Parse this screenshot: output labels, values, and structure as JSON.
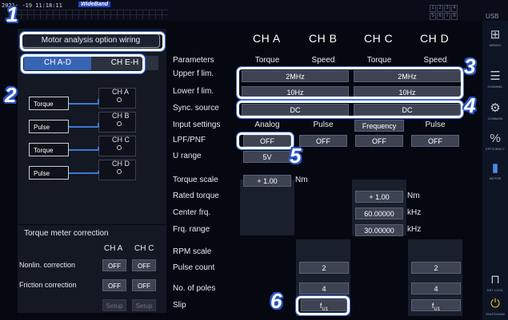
{
  "status_bar": {
    "clock": "2021-  -19 11:18:11",
    "mode": "WideBand",
    "usb": "USB",
    "channels": [
      "1",
      "2",
      "3",
      "4",
      "5",
      "6",
      "7",
      "8"
    ]
  },
  "left_panel": {
    "title": "Motor analysis option wiring",
    "tabs": [
      {
        "label": "CH A-D",
        "active": true
      },
      {
        "label": "CH E-H",
        "active": false
      }
    ],
    "wiring": [
      {
        "signal": "Torque",
        "channel": "CH A"
      },
      {
        "signal": "Pulse",
        "channel": "CH B"
      },
      {
        "signal": "Torque",
        "channel": "CH C"
      },
      {
        "signal": "Pulse",
        "channel": "CH D"
      }
    ]
  },
  "torque_meter_correction": {
    "title": "Torque meter correction",
    "columns": [
      "CH A",
      "CH C"
    ],
    "rows": [
      {
        "label": "Nonlin. correction",
        "values": [
          "OFF",
          "OFF"
        ]
      },
      {
        "label": "Friction correction",
        "values": [
          "OFF",
          "OFF"
        ]
      },
      {
        "label": "",
        "values": [
          "Setup",
          "Setup"
        ]
      }
    ]
  },
  "main": {
    "channels": [
      "CH A",
      "CH B",
      "CH C",
      "CH D"
    ],
    "row_labels": {
      "parameters": "Parameters",
      "upper": "Upper f lim.",
      "lower": "Lower f lim.",
      "sync": "Sync. source",
      "input": "Input settings",
      "lpf": "LPF/PNF",
      "urange": "U range",
      "tscale": "Torque scale",
      "rated": "Rated torque",
      "center": "Center frq.",
      "frange": "Frq. range",
      "rpm": "RPM scale",
      "pulse": "Pulse count",
      "poles": "No. of poles",
      "slip": "Slip"
    },
    "parameters": [
      "Torque",
      "Speed",
      "Torque",
      "Speed"
    ],
    "upper_f_lim": [
      "2MHz",
      "2MHz"
    ],
    "lower_f_lim": [
      "10Hz",
      "10Hz"
    ],
    "sync_source": [
      "DC",
      "DC"
    ],
    "input_settings": [
      "Analog",
      "Pulse",
      "Frequency",
      "Pulse"
    ],
    "lpf_pnf": [
      "OFF",
      "OFF",
      "OFF",
      "OFF"
    ],
    "u_range": "5V",
    "torque_scale": {
      "value": "+ 1.00",
      "unit": "Nm"
    },
    "rated_torque": {
      "value": "+ 1.00",
      "unit": "Nm"
    },
    "center_frq": {
      "value": "60.00000",
      "unit": "kHz"
    },
    "frq_range": {
      "value": "30.00000",
      "unit": "kHz"
    },
    "pulse_count": [
      "2",
      "2"
    ],
    "no_of_poles": [
      "4",
      "4"
    ],
    "slip": [
      "f",
      "f"
    ],
    "slip_sub": [
      "U1",
      "U1"
    ]
  },
  "callouts": [
    "1",
    "2",
    "3",
    "4",
    "5",
    "6"
  ],
  "sidebar": [
    {
      "icon": "wiring-icon",
      "label": "WIRING"
    },
    {
      "icon": "channel-icon",
      "label": "CHANNEL"
    },
    {
      "icon": "common-icon",
      "label": "COMMON"
    },
    {
      "icon": "efficiency-icon",
      "label": "EFFICIENCY"
    },
    {
      "icon": "motor-icon",
      "label": "MOTOR"
    },
    {
      "icon": "lock-icon",
      "label": "KEY LOCK"
    },
    {
      "icon": "shutdown-icon",
      "label": "SHUTDOWN"
    }
  ],
  "colors": {
    "accent": "#3864b4",
    "callout": "#2a55c8",
    "wire": "#3c78d8"
  }
}
